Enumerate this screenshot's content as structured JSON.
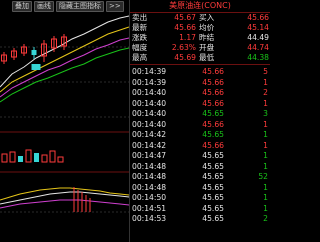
{
  "toolbar": {
    "buttons": [
      "叠加",
      "画线",
      "隐藏主图指标",
      ">>"
    ]
  },
  "quote": {
    "title": "美原油连(CONC)",
    "stats": [
      {
        "l1": "卖出",
        "v1": "45.67",
        "c1": "red",
        "l2": "买入",
        "v2": "45.66",
        "c2": "red"
      },
      {
        "l1": "最新",
        "v1": "45.66",
        "c1": "red",
        "l2": "均价",
        "v2": "45.14",
        "c2": "red"
      },
      {
        "l1": "涨跌",
        "v1": "1.17",
        "c1": "red",
        "l2": "昨结",
        "v2": "44.49",
        "c2": "white"
      },
      {
        "l1": "幅度",
        "v1": "2.63%",
        "c1": "red",
        "l2": "开盘",
        "v2": "44.74",
        "c2": "red"
      },
      {
        "l1": "最高",
        "v1": "45.69",
        "c1": "red",
        "l2": "最低",
        "v2": "44.38",
        "c2": "green"
      }
    ],
    "ticks": [
      {
        "time": "00:14:39",
        "price": "45.66",
        "pc": "red",
        "vol": "5",
        "vc": "red"
      },
      {
        "time": "00:14:39",
        "price": "45.66",
        "pc": "red",
        "vol": "1",
        "vc": "red"
      },
      {
        "time": "00:14:40",
        "price": "45.66",
        "pc": "red",
        "vol": "2",
        "vc": "red"
      },
      {
        "time": "00:14:40",
        "price": "45.66",
        "pc": "red",
        "vol": "1",
        "vc": "red"
      },
      {
        "time": "00:14:40",
        "price": "45.65",
        "pc": "green",
        "vol": "3",
        "vc": "green"
      },
      {
        "time": "00:14:40",
        "price": "45.66",
        "pc": "red",
        "vol": "1",
        "vc": "red"
      },
      {
        "time": "00:14:42",
        "price": "45.65",
        "pc": "green",
        "vol": "1",
        "vc": "green"
      },
      {
        "time": "00:14:42",
        "price": "45.66",
        "pc": "red",
        "vol": "1",
        "vc": "red"
      },
      {
        "time": "00:14:47",
        "price": "45.65",
        "pc": "white",
        "vol": "1",
        "vc": "green"
      },
      {
        "time": "00:14:48",
        "price": "45.65",
        "pc": "white",
        "vol": "1",
        "vc": "green"
      },
      {
        "time": "00:14:48",
        "price": "45.65",
        "pc": "white",
        "vol": "52",
        "vc": "green"
      },
      {
        "time": "00:14:48",
        "price": "45.65",
        "pc": "white",
        "vol": "1",
        "vc": "green"
      },
      {
        "time": "00:14:50",
        "price": "45.65",
        "pc": "white",
        "vol": "1",
        "vc": "green"
      },
      {
        "time": "00:14:51",
        "price": "45.65",
        "pc": "white",
        "vol": "1",
        "vc": "green"
      },
      {
        "time": "00:14:53",
        "price": "45.65",
        "pc": "white",
        "vol": "2",
        "vc": "green"
      }
    ]
  }
}
